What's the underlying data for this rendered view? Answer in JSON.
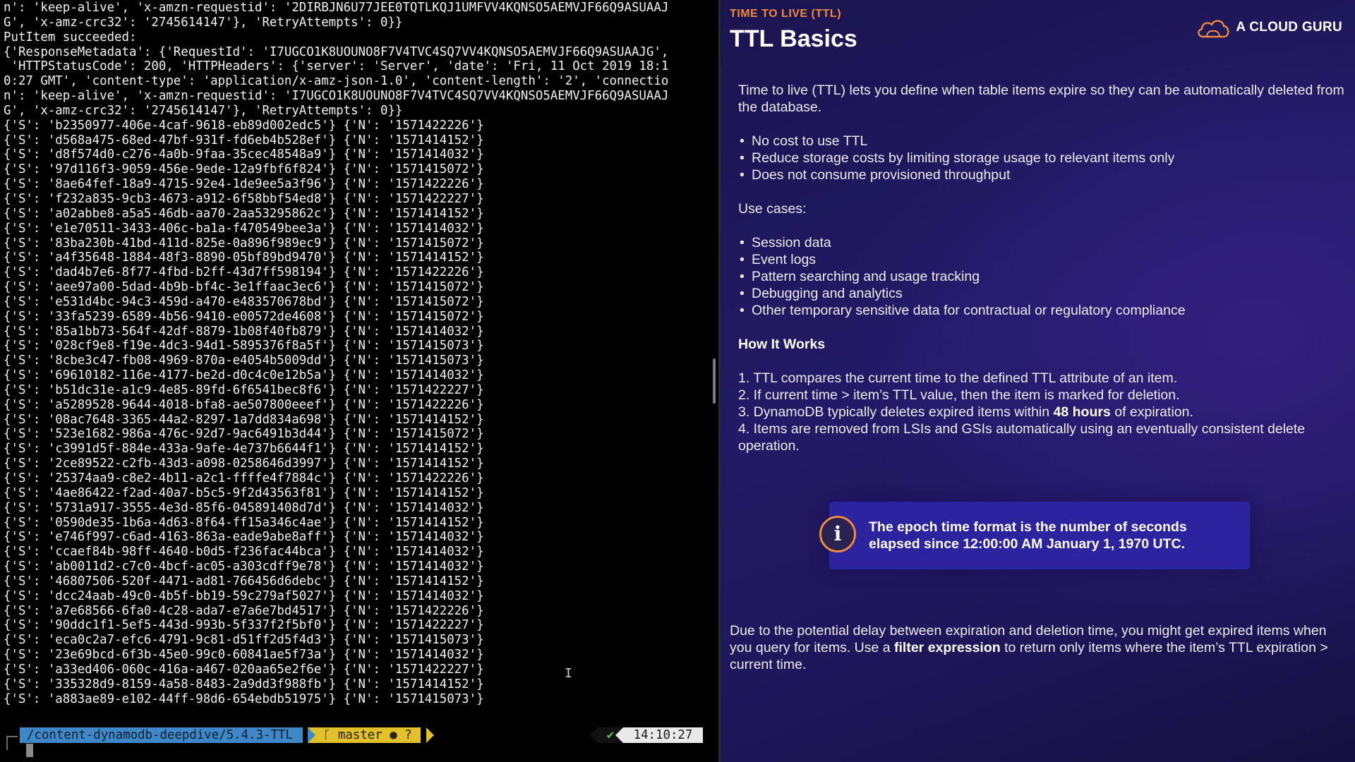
{
  "terminal": {
    "lines": [
      "n': 'keep-alive', 'x-amzn-requestid': '2DIRBJN6U77JEE0TQTLKQJ1UMFVV4KQNSO5AEMVJF66Q9ASUAAJ",
      "G', 'x-amz-crc32': '2745614147'}, 'RetryAttempts': 0}}",
      "PutItem succeeded:",
      "{'ResponseMetadata': {'RequestId': 'I7UGCO1K8UOUNO8F7V4TVC4SQ7VV4KQNSO5AEMVJF66Q9ASUAAJG',",
      " 'HTTPStatusCode': 200, 'HTTPHeaders': {'server': 'Server', 'date': 'Fri, 11 Oct 2019 18:1",
      "0:27 GMT', 'content-type': 'application/x-amz-json-1.0', 'content-length': '2', 'connectio",
      "n': 'keep-alive', 'x-amzn-requestid': 'I7UGCO1K8UOUNO8F7V4TVC4SQ7VV4KQNSO5AEMVJF66Q9ASUAAJ",
      "G', 'x-amz-crc32': '2745614147'}, 'RetryAttempts': 0}}",
      "{'S': 'b2350977-406e-4caf-9618-eb89d002edc5'} {'N': '1571422226'}",
      "{'S': 'd568a475-68ed-47bf-931f-fd6eb4b528ef'} {'N': '1571414152'}",
      "{'S': 'd8f574d0-c276-4a0b-9faa-35cec48548a9'} {'N': '1571414032'}",
      "{'S': '97d116f3-9059-456e-9ede-12a9fbf6f824'} {'N': '1571415072'}",
      "{'S': '8ae64fef-18a9-4715-92e4-1de9ee5a3f96'} {'N': '1571422226'}",
      "{'S': 'f232a835-9cb3-4673-a912-6f58bbf54ed8'} {'N': '1571422227'}",
      "{'S': 'a02abbe8-a5a5-46db-aa70-2aa53295862c'} {'N': '1571414152'}",
      "{'S': 'e1e70511-3433-406c-ba1a-f470549bee3a'} {'N': '1571414032'}",
      "{'S': '83ba230b-41bd-411d-825e-0a896f989ec9'} {'N': '1571415072'}",
      "{'S': 'a4f35648-1884-48f3-8890-05bf89bd9470'} {'N': '1571414152'}",
      "{'S': 'dad4b7e6-8f77-4fbd-b2ff-43d7ff598194'} {'N': '1571422226'}",
      "{'S': 'aee97a00-5dad-4b9b-bf4c-3e1ffaac3ec6'} {'N': '1571415072'}",
      "{'S': 'e531d4bc-94c3-459d-a470-e483570678bd'} {'N': '1571415072'}",
      "{'S': '33fa5239-6589-4b56-9410-e00572de4608'} {'N': '1571415072'}",
      "{'S': '85a1bb73-564f-42df-8879-1b08f40fb879'} {'N': '1571414032'}",
      "{'S': '028cf9e8-f19e-4dc3-94d1-5895376f8a5f'} {'N': '1571415073'}",
      "{'S': '8cbe3c47-fb08-4969-870a-e4054b5009dd'} {'N': '1571415073'}",
      "{'S': '69610182-116e-4177-be2d-d0c4c0e12b5a'} {'N': '1571414032'}",
      "{'S': 'b51dc31e-a1c9-4e85-89fd-6f6541bec8f6'} {'N': '1571422227'}",
      "{'S': 'a5289528-9644-4018-bfa8-ae507800eeef'} {'N': '1571422226'}",
      "{'S': '08ac7648-3365-44a2-8297-1a7dd834a698'} {'N': '1571414152'}",
      "{'S': '523e1682-986a-476c-92d7-9ac6491b3d44'} {'N': '1571415072'}",
      "{'S': 'c3991d5f-884e-433a-9afe-4e737b6644f1'} {'N': '1571414152'}",
      "{'S': '2ce89522-c2fb-43d3-a098-0258646d3997'} {'N': '1571414152'}",
      "{'S': '25374aa9-c8e2-4b11-a2c1-ffffe4f7884c'} {'N': '1571422226'}",
      "{'S': '4ae86422-f2ad-40a7-b5c5-9f2d43563f81'} {'N': '1571414152'}",
      "{'S': '5731a917-3555-4e3d-85f6-045891408d7d'} {'N': '1571414032'}",
      "{'S': '0590de35-1b6a-4d63-8f64-ff15a346c4ae'} {'N': '1571414152'}",
      "{'S': 'e746f997-c6ad-4163-863a-eade9abe8aff'} {'N': '1571414032'}",
      "{'S': 'ccaef84b-98ff-4640-b0d5-f236fac44bca'} {'N': '1571414032'}",
      "{'S': 'ab0011d2-c7c0-4bcf-ac05-a303cdff9e78'} {'N': '1571414032'}",
      "{'S': '46807506-520f-4471-ad81-766456d6debc'} {'N': '1571414152'}",
      "{'S': 'dcc24aab-49c0-4b5f-bb19-59c279af5027'} {'N': '1571414032'}",
      "{'S': 'a7e68566-6fa0-4c28-ada7-e7a6e7bd4517'} {'N': '1571422226'}",
      "{'S': '90ddc1f1-5ef5-443d-993b-5f337f2f5bf0'} {'N': '1571422227'}",
      "{'S': 'eca0c2a7-efc6-4791-9c81-d51ff2d5f4d3'} {'N': '1571415073'}",
      "{'S': '23e69bcd-6f3b-45e0-99c0-60841ae5f73a'} {'N': '1571414032'}",
      "{'S': 'a33ed406-060c-416a-a467-020aa65e2f6e'} {'N': '1571422227'}",
      "{'S': '335328d9-8159-4a58-8483-2a9dd3f988fb'} {'N': '1571414152'}",
      "{'S': 'a883ae89-e102-44ff-98d6-654ebdb51975'} {'N': '1571415073'}"
    ],
    "prompt": {
      "path": "/content-dynamodb-deepdive/5.4.3-TTL",
      "git": "ᚴ master ● ?",
      "check": "✔",
      "time": "14:10:27"
    },
    "icons": {
      "cursor": "cursor-block-icon",
      "ibeam": "text-cursor-icon"
    },
    "colors": {
      "path_segment": "#3f88c8",
      "git_segment": "#e1c02a",
      "ok_check": "#4fc34f"
    }
  },
  "slide": {
    "kicker": "TIME TO LIVE (TTL)",
    "title": "TTL Basics",
    "brand": "A CLOUD GURU",
    "intro": "Time to live (TTL) lets you define when table items expire so they can be automatically deleted from the database.",
    "benefits": [
      "No cost to use TTL",
      "Reduce storage costs by limiting storage usage to relevant items only",
      "Does not consume provisioned throughput"
    ],
    "use_cases_label": "Use cases:",
    "use_cases": [
      "Session data",
      "Event logs",
      "Pattern searching and usage tracking",
      "Debugging and analytics",
      "Other temporary sensitive data for contractual or regulatory compliance"
    ],
    "how_heading": "How It Works",
    "steps": {
      "s1": "1. TTL compares the current time to the defined TTL attribute of an item.",
      "s2": "2. If current time > item’s TTL value, then the item is marked for deletion.",
      "s3_pre": "3. DynamoDB typically deletes expired items within ",
      "s3_bold": "48 hours",
      "s3_post": " of expiration.",
      "s4": "4. Items are removed from LSIs and GSIs automatically using an eventually consistent delete operation."
    },
    "callout_icon_glyph": "i",
    "callout": "The epoch time format is the number of seconds elapsed since 12:00:00 AM January 1, 1970 UTC.",
    "footer": {
      "pre": "Due to the potential delay between expiration and deletion time, you might get expired items when you query for items. Use a ",
      "bold": "filter expression",
      "post": " to return only items where the item’s TTL expiration > current time."
    },
    "icons": {
      "brand_logo": "cloud-logo-icon",
      "callout": "info-icon"
    },
    "colors": {
      "accent": "#f08a3c",
      "background": "#1d1658",
      "callout_bg": "#2c249e"
    }
  }
}
